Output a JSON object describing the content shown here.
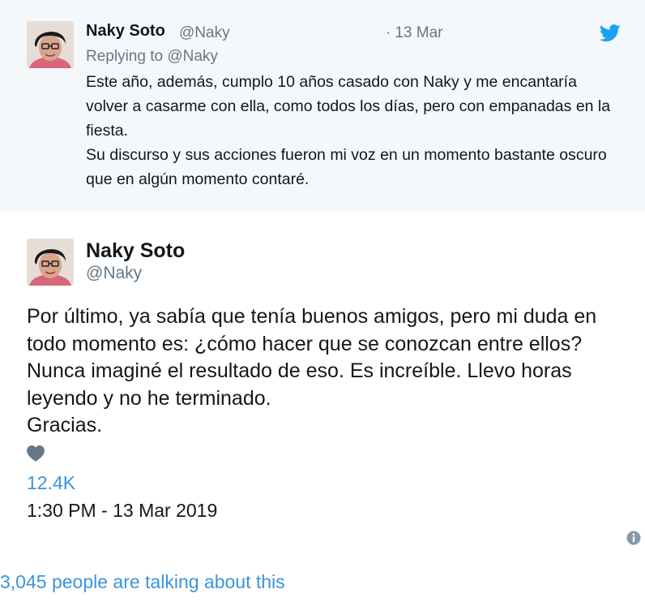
{
  "reply_tweet": {
    "name": "Naky Soto",
    "handle": "@Naky",
    "date_separator": "·",
    "date": "13 Mar",
    "replying_label": "Replying to",
    "replying_handle": "@Naky",
    "text_lines": [
      "Este año, además, cumplo 10 años casado con Naky y me encantaría volver a casarme con ella, como todos los días, pero con empanadas en la fiesta.",
      "Su discurso y sus acciones fueron mi voz en un momento bastante oscuro que en algún momento contaré."
    ]
  },
  "main_tweet": {
    "name": "Naky Soto",
    "handle": "@Naky",
    "text_lines": [
      "Por último, ya sabía que tenía buenos amigos, pero mi duda en todo momento es: ¿cómo hacer que se conozcan entre ellos? Nunca imaginé el resultado de eso. Es increíble. Llevo horas leyendo y no he terminado.",
      "Gracias."
    ],
    "like_count": "12.4K",
    "timestamp": "1:30 PM - 13 Mar 2019"
  },
  "footer": {
    "talking_text": "3,045 people are talking about this"
  },
  "icons": {
    "brand": "twitter-bird-icon",
    "like": "heart-icon",
    "info": "info-icon"
  },
  "colors": {
    "reply_background": "#f5f8fa",
    "accent_blue": "#3b94d9",
    "twitter_blue": "#1da1f2",
    "muted_text": "#657786",
    "primary_text": "#14171a",
    "heart_gray": "#657786"
  }
}
